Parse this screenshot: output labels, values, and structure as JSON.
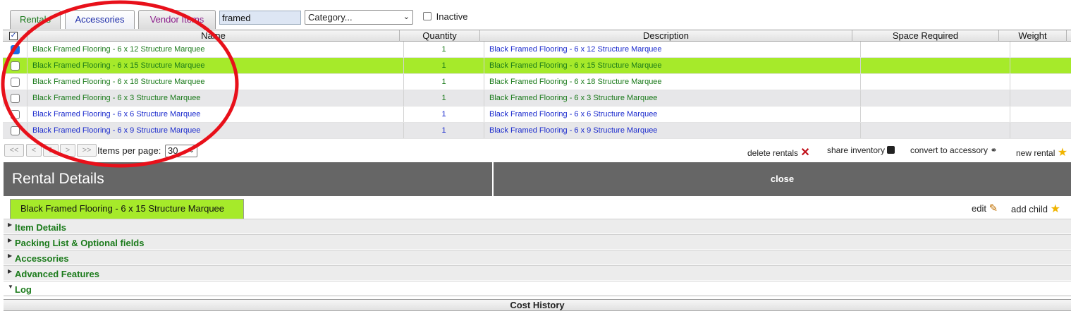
{
  "tabs": {
    "rentals": "Rentals",
    "accessories": "Accessories",
    "vendor": "Vendor Items"
  },
  "search": {
    "value": "framed"
  },
  "category": {
    "selected": "Category..."
  },
  "inactive_label": "Inactive",
  "table": {
    "columns": {
      "name": "Name",
      "quantity": "Quantity",
      "description": "Description",
      "space": "Space Required",
      "weight": "Weight"
    },
    "rows": [
      {
        "name": "Black Framed Flooring - 6 x 12 Structure Marquee",
        "qty": "1",
        "desc": "Black Framed Flooring - 6 x 12 Structure Marquee",
        "checked": true
      },
      {
        "name": "Black Framed Flooring - 6 x 15 Structure Marquee",
        "qty": "1",
        "desc": "Black Framed Flooring - 6 x 15 Structure Marquee",
        "checked": false
      },
      {
        "name": "Black Framed Flooring - 6 x 18 Structure Marquee",
        "qty": "1",
        "desc": "Black Framed Flooring - 6 x 18 Structure Marquee",
        "checked": false
      },
      {
        "name": "Black Framed Flooring - 6 x 3 Structure Marquee",
        "qty": "1",
        "desc": "Black Framed Flooring - 6 x 3 Structure Marquee",
        "checked": false
      },
      {
        "name": "Black Framed Flooring - 6 x 6 Structure Marquee",
        "qty": "1",
        "desc": "Black Framed Flooring - 6 x 6 Structure Marquee",
        "checked": false
      },
      {
        "name": "Black Framed Flooring - 6 x 9 Structure Marquee",
        "qty": "1",
        "desc": "Black Framed Flooring - 6 x 9 Structure Marquee",
        "checked": false
      }
    ]
  },
  "pager": {
    "first": "<<",
    "prev": "<",
    "page": "1",
    "next": ">",
    "last": ">>",
    "items_label": "Items per page:",
    "items_value": "30"
  },
  "actions": {
    "delete": "delete rentals",
    "share": "share inventory",
    "convert": "convert to accessory",
    "new": "new rental"
  },
  "details": {
    "title": "Rental Details",
    "close": "close",
    "item_tab": "Black Framed Flooring - 6 x 15 Structure Marquee",
    "edit": "edit",
    "add_child": "add child",
    "sections": [
      "Item Details",
      "Packing List & Optional fields",
      "Accessories",
      "Advanced Features",
      "Log"
    ],
    "cost_history": "Cost History"
  },
  "colors": {
    "selected_row": "#a6ea2a",
    "header_gray": "#666666",
    "green_text": "#1a7a1a",
    "blue_text": "#1a2acd",
    "annotation": "#e8101a"
  }
}
